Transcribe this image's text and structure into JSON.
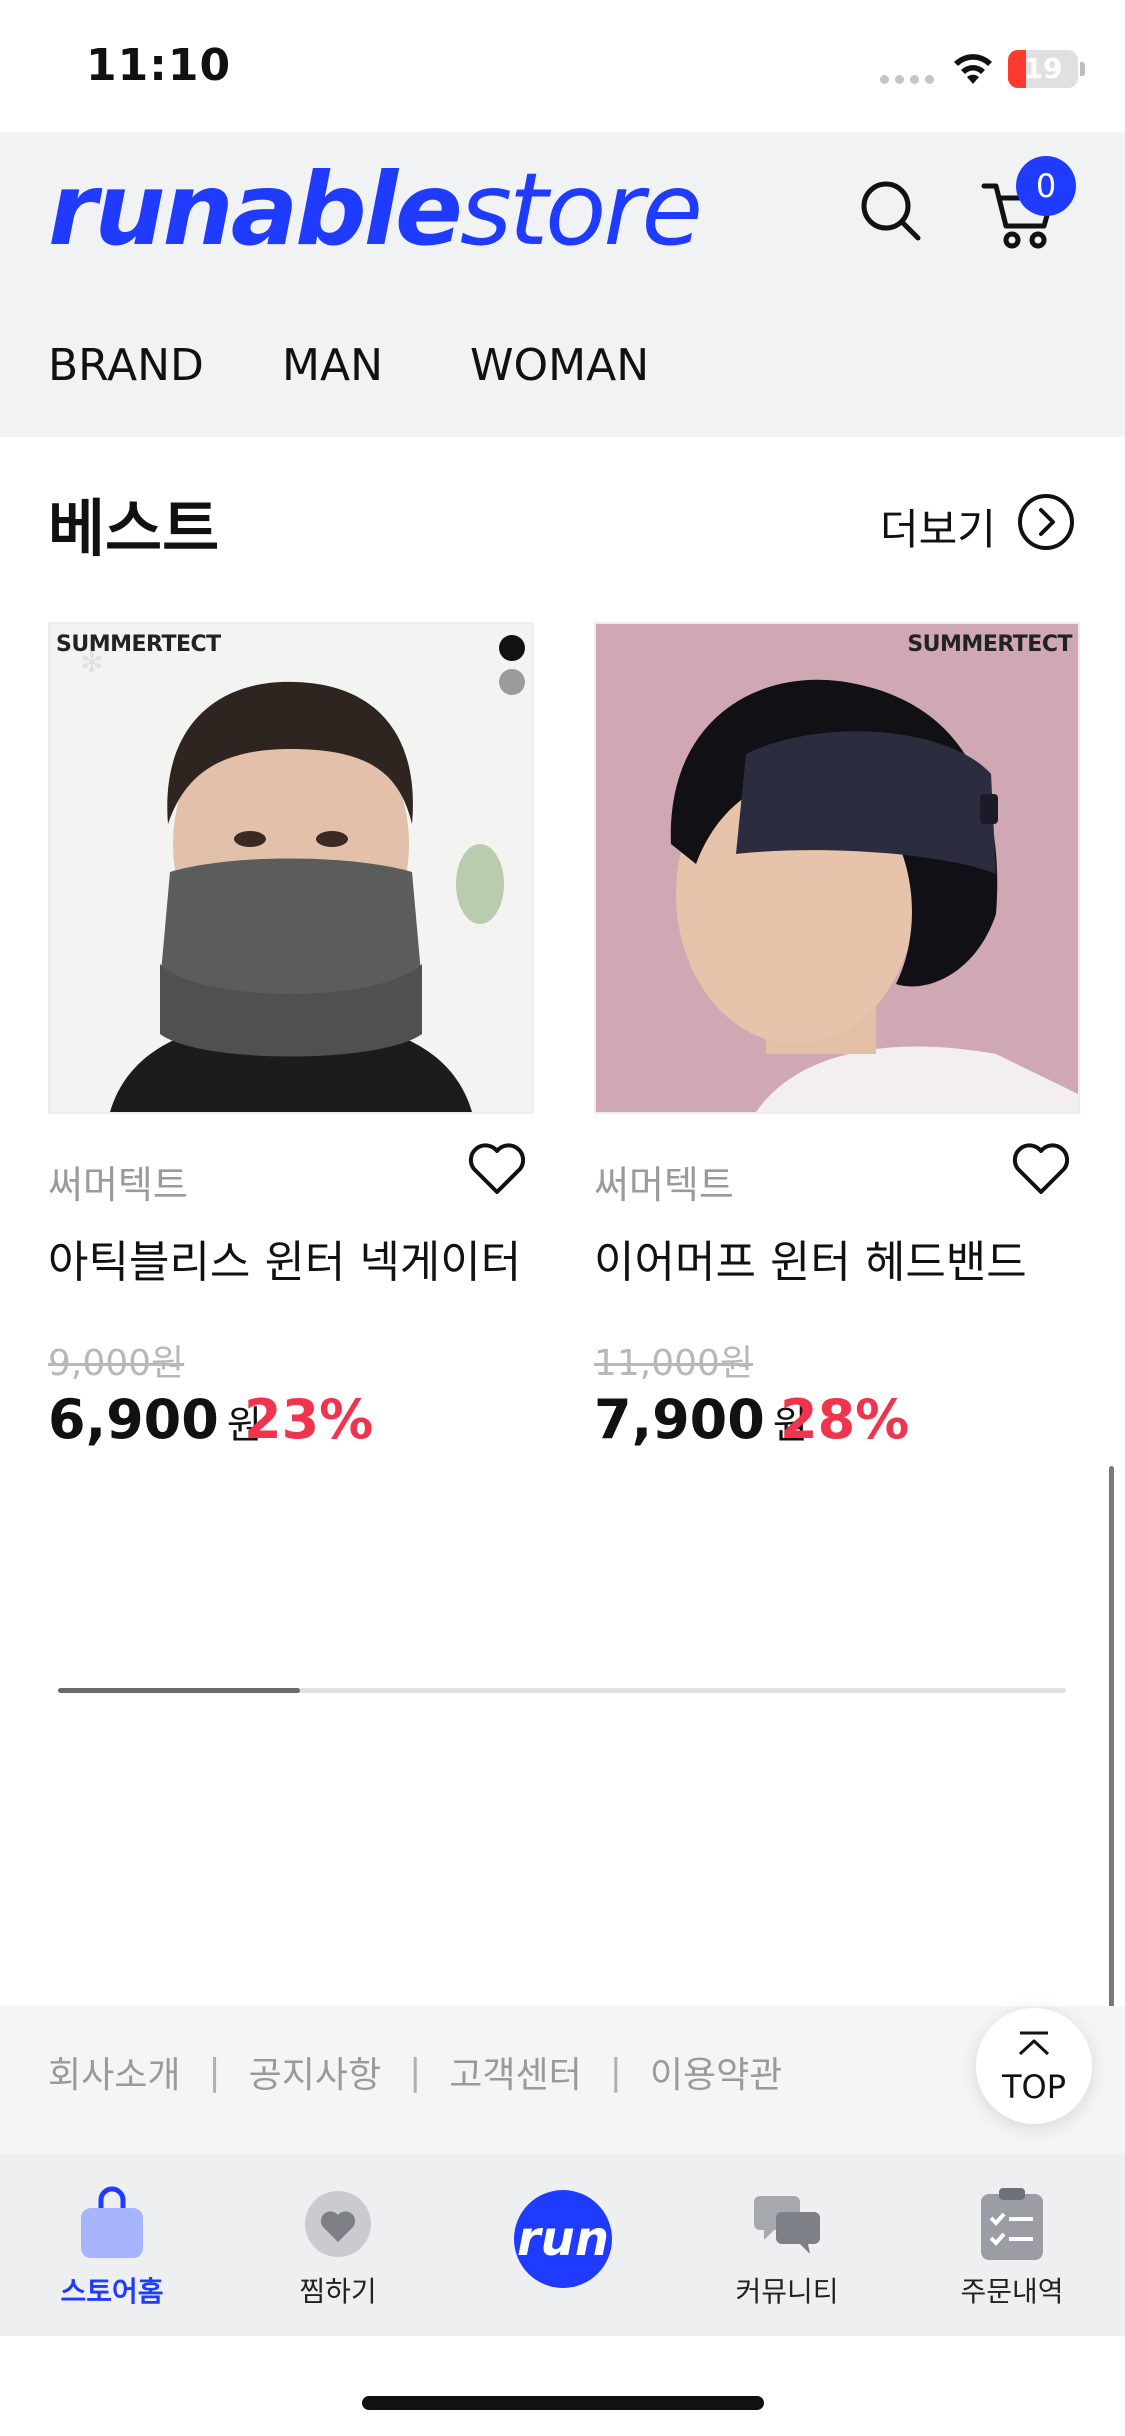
{
  "status_bar": {
    "time": "11:10",
    "battery": "19"
  },
  "header": {
    "logo_bold": "runable",
    "logo_light": "store",
    "cart_count": "0",
    "nav": [
      "BRAND",
      "MAN",
      "WOMAN"
    ]
  },
  "best": {
    "title": "베스트",
    "more_label": "더보기",
    "products": [
      {
        "brand_tag": "SUMMERTECT",
        "seller": "써머텍트",
        "name": "아틱블리스 윈터 넥게이터",
        "original_price": "9,000원",
        "price": "6,900",
        "currency": "원",
        "discount": "23%"
      },
      {
        "brand_tag": "SUMMERTECT",
        "seller": "써머텍트",
        "name": "이어머프 윈터 헤드밴드",
        "original_price": "11,000원",
        "price": "7,900",
        "currency": "원",
        "discount": "28%"
      }
    ]
  },
  "footer": {
    "links": [
      "회사소개",
      "공지사항",
      "고객센터",
      "이용약관"
    ],
    "top_label": "TOP"
  },
  "tabbar": {
    "home": "스토어홈",
    "wishlist": "찜하기",
    "center_logo": "run",
    "community": "커뮤니티",
    "orders": "주문내역"
  },
  "colors": {
    "accent": "#1f3bff",
    "discount": "#f0344d",
    "header_bg": "#f1f2f4"
  }
}
